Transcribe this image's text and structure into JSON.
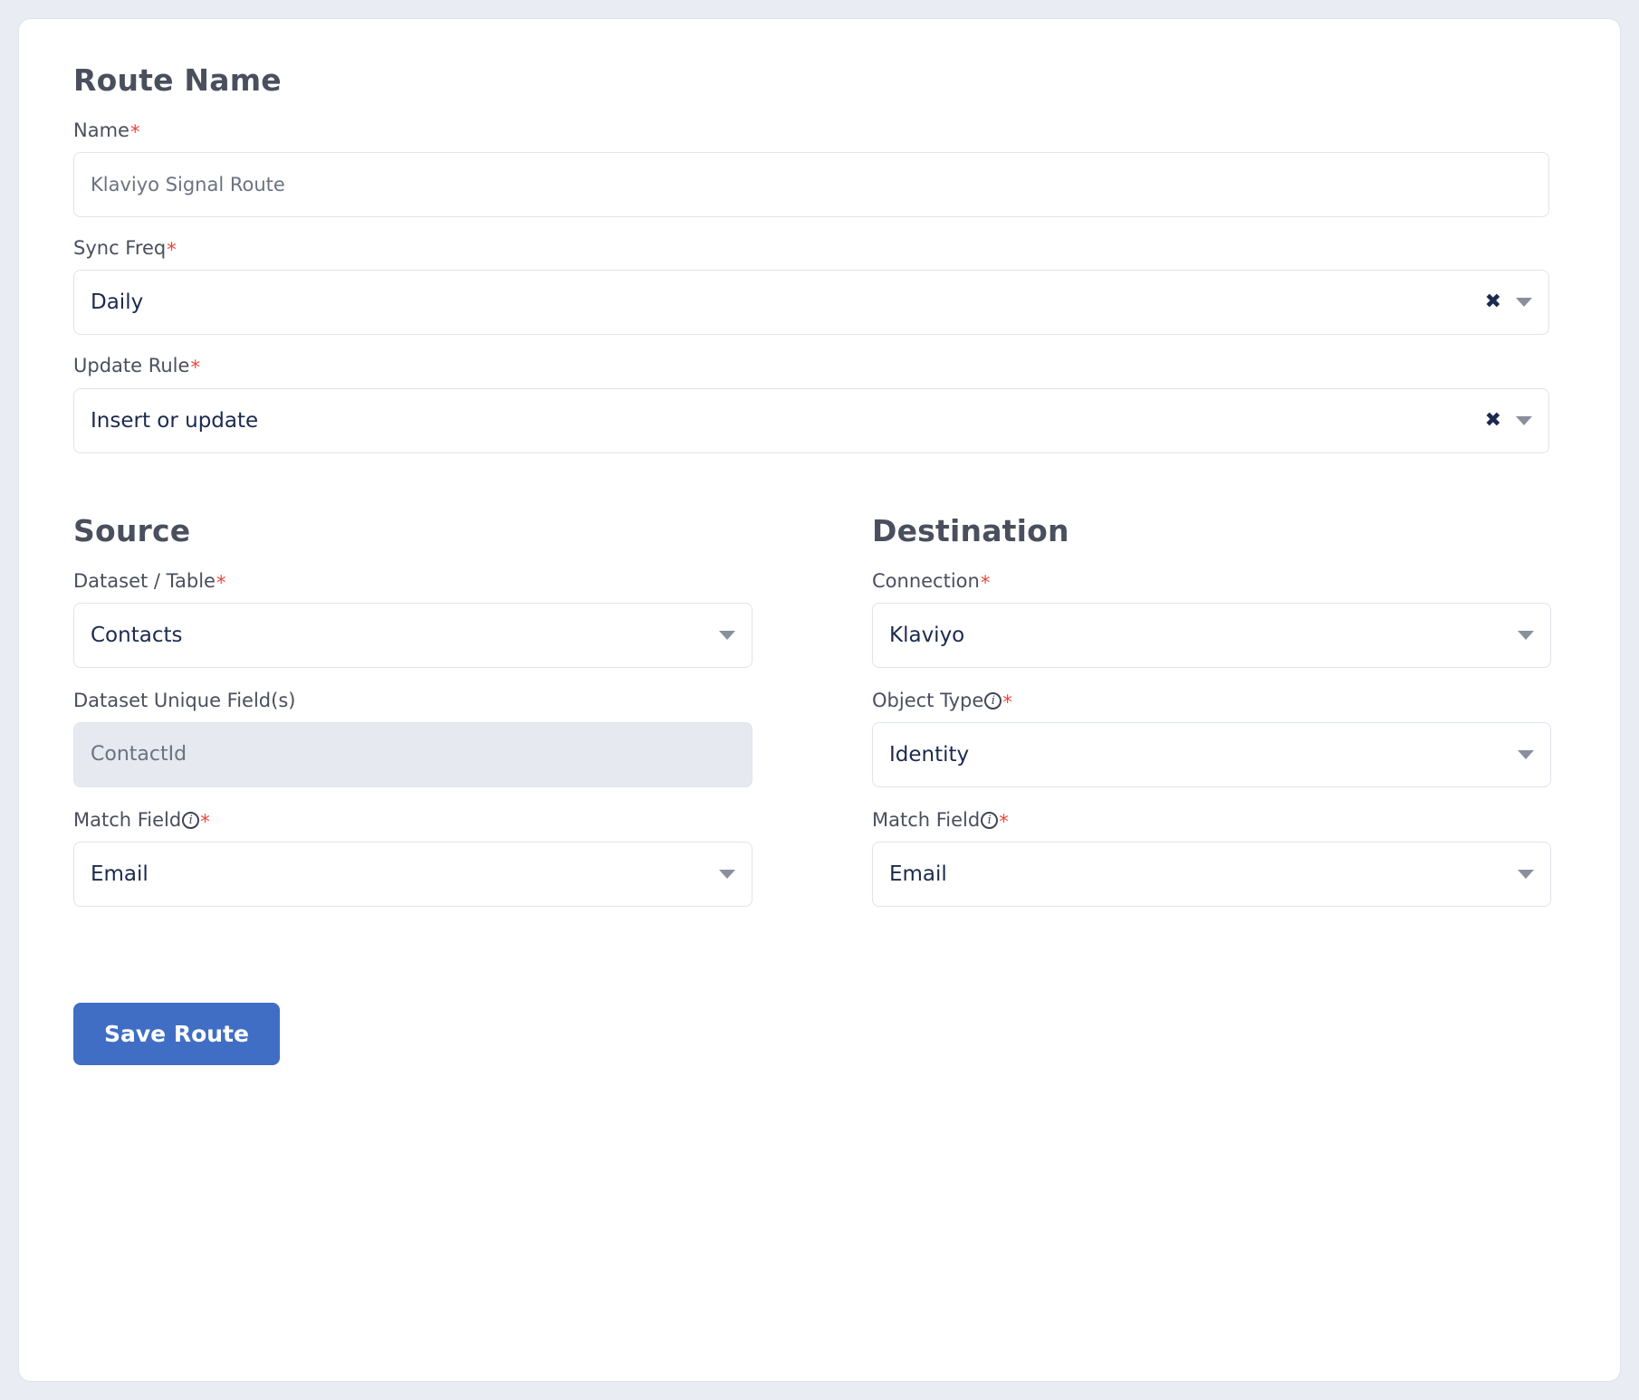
{
  "route_section": {
    "title": "Route Name",
    "name": {
      "label": "Name",
      "required_marker": "*",
      "value": "Klaviyo Signal Route"
    },
    "sync_freq": {
      "label": "Sync Freq",
      "required_marker": "*",
      "value": "Daily",
      "clear_icon": "×",
      "clear_glyph": "✖"
    },
    "update_rule": {
      "label": "Update Rule",
      "required_marker": "*",
      "value": "Insert or update",
      "clear_glyph": "✖"
    }
  },
  "source": {
    "title": "Source",
    "dataset_table": {
      "label": "Dataset / Table",
      "required_marker": "*",
      "value": "Contacts"
    },
    "unique_fields": {
      "label": "Dataset Unique Field(s)",
      "value": "ContactId"
    },
    "match_field": {
      "label": "Match Field",
      "info_glyph": "i",
      "required_marker": "*",
      "value": "Email"
    }
  },
  "destination": {
    "title": "Destination",
    "connection": {
      "label": "Connection",
      "required_marker": "*",
      "value": "Klaviyo"
    },
    "object_type": {
      "label": "Object Type",
      "info_glyph": "i",
      "required_marker": "*",
      "value": "Identity"
    },
    "match_field": {
      "label": "Match Field",
      "info_glyph": "i",
      "required_marker": "*",
      "value": "Email"
    }
  },
  "actions": {
    "save_label": "Save Route"
  },
  "colors": {
    "page_background": "#e9ecf3",
    "card_background": "#ffffff",
    "border": "#dfe3ec",
    "heading_text": "#4a4f5e",
    "value_text": "#1b2a4e",
    "muted_text": "#6b7280",
    "required_red": "#f04438",
    "primary_button": "#3f6ec4",
    "disabled_field": "#e6e9f0"
  }
}
